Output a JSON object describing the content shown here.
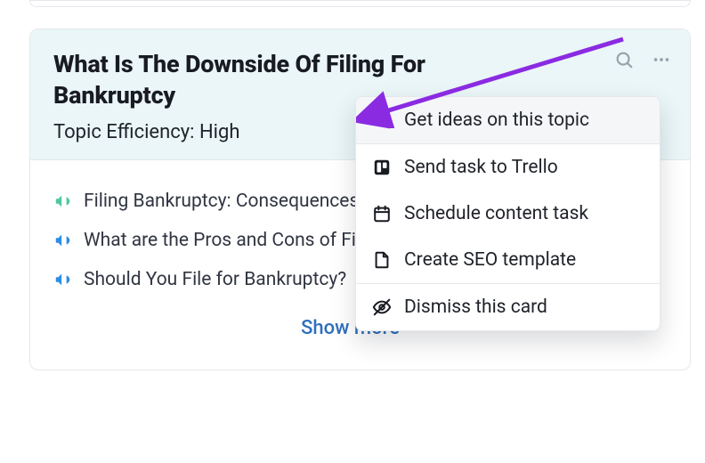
{
  "card": {
    "title": "What Is The Downside Of Filing For Bankruptcy",
    "efficiency_label": "Topic Efficiency:",
    "efficiency_value": "High",
    "show_more": "Show more"
  },
  "rows": [
    {
      "icon": "megaphone-icon",
      "color": "#4ec9a0",
      "text": "Filing Bankruptcy: Consequences"
    },
    {
      "icon": "megaphone-icon",
      "color": "#2f8de4",
      "text": "What are the Pros and Cons of Filing Bankruptcy"
    },
    {
      "icon": "megaphone-icon",
      "color": "#2f8de4",
      "text": "Should You File for Bankruptcy?"
    }
  ],
  "menu": {
    "items": [
      {
        "icon": "search-icon",
        "label": "Get ideas on this topic",
        "hover": true
      },
      {
        "icon": "trello-icon",
        "label": "Send task to Trello"
      },
      {
        "icon": "calendar-icon",
        "label": "Schedule content task"
      },
      {
        "icon": "file-icon",
        "label": "Create SEO template"
      },
      {
        "sep": true
      },
      {
        "icon": "eye-off-icon",
        "label": "Dismiss this card"
      }
    ]
  },
  "colors": {
    "accent_arrow": "#8a2be2"
  }
}
